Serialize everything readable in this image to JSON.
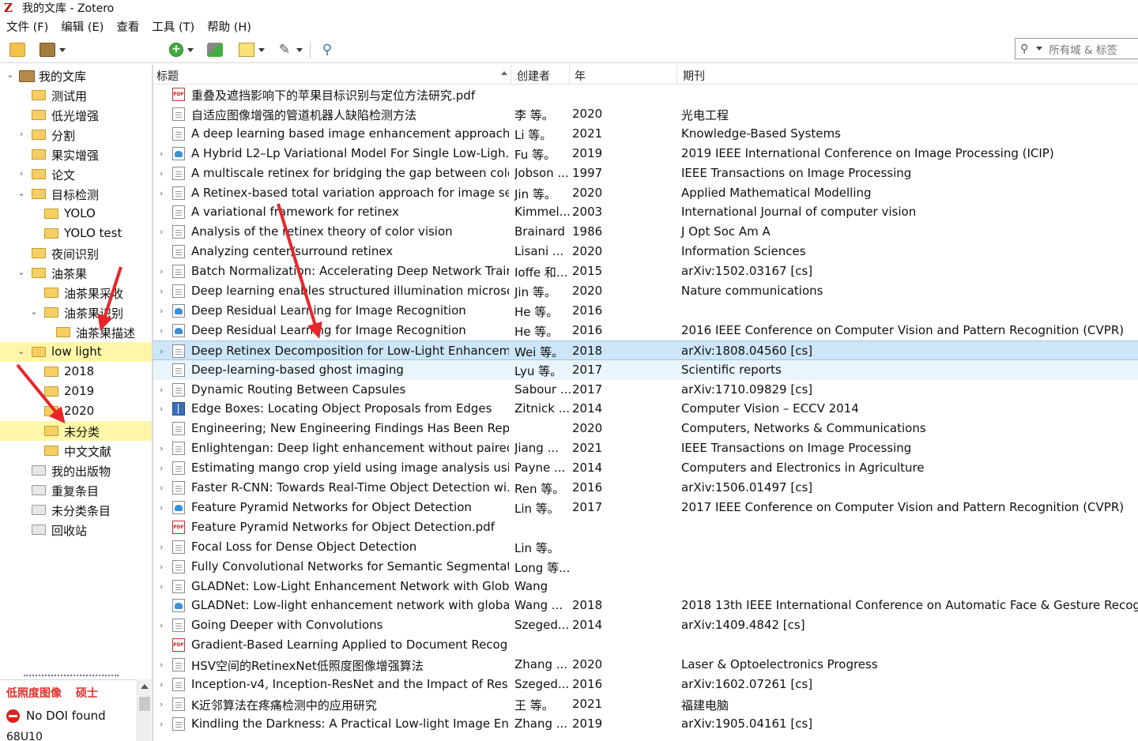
{
  "window": {
    "title": "我的文库 - Zotero",
    "logo": "Z"
  },
  "menu": [
    "文件 (F)",
    "编辑 (E)",
    "查看",
    "工具 (T)",
    "帮助 (H)"
  ],
  "search": {
    "placeholder": "所有域 & 标签"
  },
  "collections": [
    {
      "label": "我的文库",
      "level": 0,
      "icon": "library-icon",
      "twisty": "open"
    },
    {
      "label": "测试用",
      "level": 1,
      "icon": "folder-icon",
      "twisty": "none"
    },
    {
      "label": "低光增强",
      "level": 1,
      "icon": "folder-icon",
      "twisty": "none"
    },
    {
      "label": "分割",
      "level": 1,
      "icon": "folder-icon",
      "twisty": "closed"
    },
    {
      "label": "果实增强",
      "level": 1,
      "icon": "folder-icon",
      "twisty": "none"
    },
    {
      "label": "论文",
      "level": 1,
      "icon": "folder-icon",
      "twisty": "closed"
    },
    {
      "label": "目标检测",
      "level": 1,
      "icon": "folder-icon",
      "twisty": "open"
    },
    {
      "label": "YOLO",
      "level": 2,
      "icon": "folder-icon",
      "twisty": "none"
    },
    {
      "label": "YOLO test",
      "level": 2,
      "icon": "folder-icon",
      "twisty": "none"
    },
    {
      "label": "夜间识别",
      "level": 1,
      "icon": "folder-icon",
      "twisty": "none"
    },
    {
      "label": "油茶果",
      "level": 1,
      "icon": "folder-icon",
      "twisty": "open"
    },
    {
      "label": "油茶果采收",
      "level": 2,
      "icon": "folder-icon",
      "twisty": "none"
    },
    {
      "label": "油茶果识别",
      "level": 2,
      "icon": "folder-icon",
      "twisty": "open"
    },
    {
      "label": "油茶果描述",
      "level": 3,
      "icon": "folder-icon",
      "twisty": "none"
    },
    {
      "label": "low light",
      "level": 1,
      "icon": "folder-icon",
      "twisty": "open",
      "highlight": true
    },
    {
      "label": "2018",
      "level": 2,
      "icon": "folder-icon",
      "twisty": "none"
    },
    {
      "label": "2019",
      "level": 2,
      "icon": "folder-icon",
      "twisty": "none"
    },
    {
      "label": "2020",
      "level": 2,
      "icon": "folder-icon",
      "twisty": "none"
    },
    {
      "label": "未分类",
      "level": 2,
      "icon": "folder-icon",
      "twisty": "none",
      "highlight": true
    },
    {
      "label": "中文文献",
      "level": 2,
      "icon": "folder-icon",
      "twisty": "none"
    },
    {
      "label": "我的出版物",
      "level": 1,
      "icon": "publications-icon",
      "twisty": "none"
    },
    {
      "label": "重复条目",
      "level": 1,
      "icon": "duplicates-icon",
      "twisty": "none"
    },
    {
      "label": "未分类条目",
      "level": 1,
      "icon": "unfiled-icon",
      "twisty": "none"
    },
    {
      "label": "回收站",
      "level": 1,
      "icon": "trash-icon",
      "twisty": "none"
    }
  ],
  "tags": {
    "tag1": "低照度图像",
    "tag2": "硕士",
    "nodoi": "No DOI found",
    "code": "68U10"
  },
  "columns": {
    "title": "标题",
    "creator": "创建者",
    "year": "年",
    "publication": "期刊"
  },
  "items": [
    {
      "icon": "pdf",
      "twisty": false,
      "title": "重叠及遮挡影响下的苹果目标识别与定位方法研究.pdf",
      "creator": "",
      "year": "",
      "pub": ""
    },
    {
      "icon": "doc",
      "twisty": false,
      "title": "自适应图像增强的管道机器人缺陷检测方法",
      "creator": "李 等。",
      "year": "2020",
      "pub": "光电工程"
    },
    {
      "icon": "doc",
      "twisty": false,
      "title": "A deep learning based image enhancement approach ...",
      "creator": "Li 等。",
      "year": "2021",
      "pub": "Knowledge-Based Systems"
    },
    {
      "icon": "conf",
      "twisty": true,
      "title": "A Hybrid L2–Lp Variational Model For Single Low-Ligh...",
      "creator": "Fu 等。",
      "year": "2019",
      "pub": "2019 IEEE International Conference on Image Processing (ICIP)"
    },
    {
      "icon": "doc",
      "twisty": true,
      "title": "A multiscale retinex for bridging the gap between colo...",
      "creator": "Jobson ...",
      "year": "1997",
      "pub": "IEEE Transactions on Image Processing"
    },
    {
      "icon": "doc",
      "twisty": true,
      "title": "A Retinex-based total variation approach for image se...",
      "creator": "Jin 等。",
      "year": "2020",
      "pub": "Applied Mathematical Modelling"
    },
    {
      "icon": "doc",
      "twisty": false,
      "title": "A variational framework for retinex",
      "creator": "Kimmel...",
      "year": "2003",
      "pub": "International Journal of computer vision"
    },
    {
      "icon": "doc",
      "twisty": true,
      "title": "Analysis of the retinex theory of color vision",
      "creator": "Brainard",
      "year": "1986",
      "pub": "J Opt Soc Am A"
    },
    {
      "icon": "doc",
      "twisty": false,
      "title": "Analyzing center/surround retinex",
      "creator": "Lisani ...",
      "year": "2020",
      "pub": "Information Sciences"
    },
    {
      "icon": "doc",
      "twisty": true,
      "title": "Batch Normalization: Accelerating Deep Network Train...",
      "creator": "Ioffe 和...",
      "year": "2015",
      "pub": "arXiv:1502.03167 [cs]"
    },
    {
      "icon": "doc",
      "twisty": true,
      "title": "Deep learning enables structured illumination microsc...",
      "creator": "Jin 等。",
      "year": "2020",
      "pub": "Nature communications"
    },
    {
      "icon": "conf",
      "twisty": true,
      "title": "Deep Residual Learning for Image Recognition",
      "creator": "He 等。",
      "year": "2016",
      "pub": ""
    },
    {
      "icon": "conf",
      "twisty": true,
      "title": "Deep Residual Learning for Image Recognition",
      "creator": "He 等。",
      "year": "2016",
      "pub": "2016 IEEE Conference on Computer Vision and Pattern Recognition (CVPR)"
    },
    {
      "icon": "doc",
      "twisty": true,
      "title": "Deep Retinex Decomposition for Low-Light Enhancem...",
      "creator": "Wei 等。",
      "year": "2018",
      "pub": "arXiv:1808.04560 [cs]",
      "state": "selected"
    },
    {
      "icon": "doc",
      "twisty": false,
      "title": "Deep-learning-based ghost imaging",
      "creator": "Lyu 等。",
      "year": "2017",
      "pub": "Scientific reports",
      "state": "alt"
    },
    {
      "icon": "doc",
      "twisty": true,
      "title": "Dynamic Routing Between Capsules",
      "creator": "Sabour ...",
      "year": "2017",
      "pub": "arXiv:1710.09829 [cs]"
    },
    {
      "icon": "book",
      "twisty": true,
      "title": "Edge Boxes: Locating Object Proposals from Edges",
      "creator": "Zitnick ...",
      "year": "2014",
      "pub": "Computer Vision – ECCV 2014"
    },
    {
      "icon": "doc",
      "twisty": false,
      "title": "Engineering; New Engineering Findings Has Been Rep...",
      "creator": "",
      "year": "2020",
      "pub": "Computers, Networks & Communications"
    },
    {
      "icon": "doc",
      "twisty": true,
      "title": "Enlightengan: Deep light enhancement without paired...",
      "creator": "Jiang ...",
      "year": "2021",
      "pub": "IEEE Transactions on Image Processing"
    },
    {
      "icon": "doc",
      "twisty": true,
      "title": "Estimating mango crop yield using image analysis usin...",
      "creator": "Payne ...",
      "year": "2014",
      "pub": "Computers and Electronics in Agriculture"
    },
    {
      "icon": "doc",
      "twisty": true,
      "title": "Faster R-CNN: Towards Real-Time Object Detection wi...",
      "creator": "Ren 等。",
      "year": "2016",
      "pub": "arXiv:1506.01497 [cs]"
    },
    {
      "icon": "conf",
      "twisty": true,
      "title": "Feature Pyramid Networks for Object Detection",
      "creator": "Lin 等。",
      "year": "2017",
      "pub": "2017 IEEE Conference on Computer Vision and Pattern Recognition (CVPR)"
    },
    {
      "icon": "pdf",
      "twisty": false,
      "title": "Feature Pyramid Networks for Object Detection.pdf",
      "creator": "",
      "year": "",
      "pub": ""
    },
    {
      "icon": "doc",
      "twisty": true,
      "title": "Focal Loss for Dense Object Detection",
      "creator": "Lin 等。",
      "year": "",
      "pub": ""
    },
    {
      "icon": "doc",
      "twisty": true,
      "title": "Fully Convolutional Networks for Semantic Segmentati...",
      "creator": "Long 等...",
      "year": "",
      "pub": ""
    },
    {
      "icon": "doc",
      "twisty": true,
      "title": "GLADNet: Low-Light Enhancement Network with Glob...",
      "creator": "Wang",
      "year": "",
      "pub": ""
    },
    {
      "icon": "conf",
      "twisty": false,
      "title": "GLADNet: Low-light enhancement network with global...",
      "creator": "Wang ...",
      "year": "2018",
      "pub": "2018 13th IEEE International Conference on Automatic Face & Gesture Recognition"
    },
    {
      "icon": "doc",
      "twisty": true,
      "title": "Going Deeper with Convolutions",
      "creator": "Szeged...",
      "year": "2014",
      "pub": "arXiv:1409.4842 [cs]"
    },
    {
      "icon": "pdf",
      "twisty": false,
      "title": "Gradient-Based Learning Applied to Document Recog...",
      "creator": "",
      "year": "",
      "pub": ""
    },
    {
      "icon": "doc",
      "twisty": true,
      "title": "HSV空间的RetinexNet低照度图像增强算法",
      "creator": "Zhang ...",
      "year": "2020",
      "pub": "Laser & Optoelectronics Progress"
    },
    {
      "icon": "doc",
      "twisty": true,
      "title": "Inception-v4, Inception-ResNet and the Impact of Resi...",
      "creator": "Szeged...",
      "year": "2016",
      "pub": "arXiv:1602.07261 [cs]"
    },
    {
      "icon": "doc",
      "twisty": true,
      "title": "K近邻算法在疼痛检测中的应用研究",
      "creator": "王 等。",
      "year": "2021",
      "pub": "福建电脑"
    },
    {
      "icon": "doc",
      "twisty": true,
      "title": "Kindling the Darkness: A Practical Low-light Image Enh...",
      "creator": "Zhang ...",
      "year": "2019",
      "pub": "arXiv:1905.04161 [cs]"
    }
  ]
}
